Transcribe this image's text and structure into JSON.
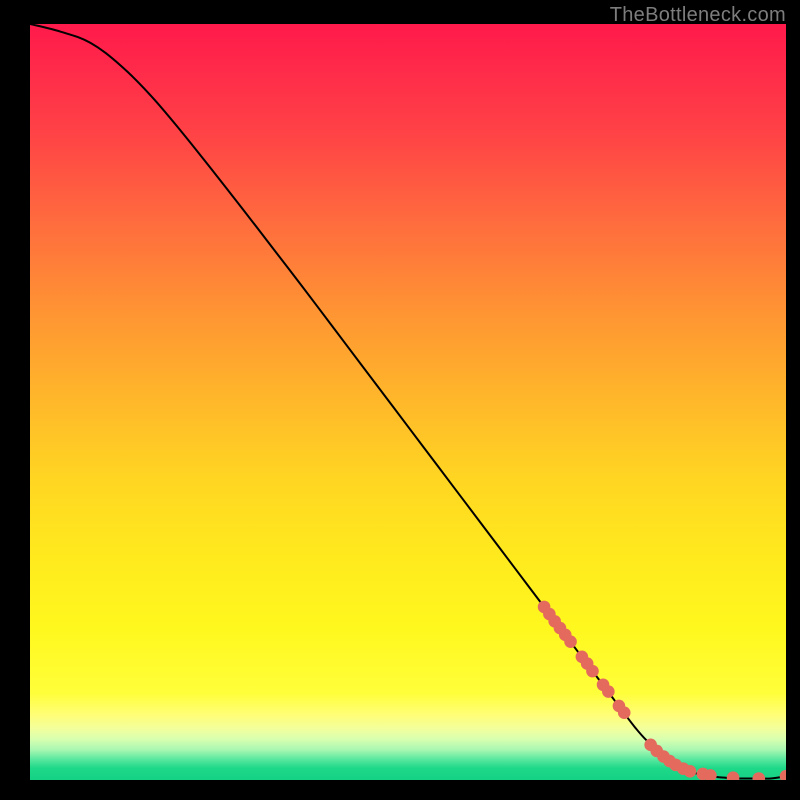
{
  "watermark": "TheBottleneck.com",
  "chart_data": {
    "type": "line",
    "title": "",
    "xlabel": "",
    "ylabel": "",
    "xlim": [
      0,
      100
    ],
    "ylim": [
      0,
      100
    ],
    "grid": false,
    "legend": false,
    "series": [
      {
        "name": "curve",
        "style": "line",
        "color": "#000000",
        "x": [
          0,
          4,
          8,
          12,
          16,
          20,
          24,
          28,
          32,
          36,
          40,
          44,
          48,
          52,
          56,
          60,
          64,
          68,
          72,
          76,
          80,
          82,
          84,
          86,
          88,
          90,
          92,
          94,
          96,
          98,
          100
        ],
        "y": [
          100,
          99.0,
          97.5,
          94.5,
          90.5,
          85.8,
          80.8,
          75.7,
          70.5,
          65.3,
          60.0,
          54.7,
          49.4,
          44.1,
          38.8,
          33.5,
          28.2,
          22.9,
          17.6,
          12.3,
          7.0,
          4.8,
          3.0,
          1.7,
          0.9,
          0.5,
          0.3,
          0.2,
          0.2,
          0.2,
          0.5
        ]
      },
      {
        "name": "markers",
        "style": "scatter",
        "color": "#e46a5e",
        "x": [
          68.0,
          68.7,
          69.4,
          70.1,
          70.8,
          71.5,
          73.0,
          73.7,
          74.4,
          75.8,
          76.5,
          77.9,
          78.6,
          82.1,
          82.9,
          83.8,
          84.6,
          85.4,
          86.4,
          87.3,
          89.0,
          90.0,
          93.0,
          96.4,
          100.0
        ],
        "y": [
          22.9,
          21.95,
          21.0,
          20.1,
          19.2,
          18.3,
          16.3,
          15.4,
          14.4,
          12.6,
          11.7,
          9.8,
          8.9,
          4.65,
          3.85,
          3.1,
          2.5,
          2.0,
          1.5,
          1.15,
          0.8,
          0.6,
          0.3,
          0.2,
          0.5
        ]
      }
    ]
  }
}
